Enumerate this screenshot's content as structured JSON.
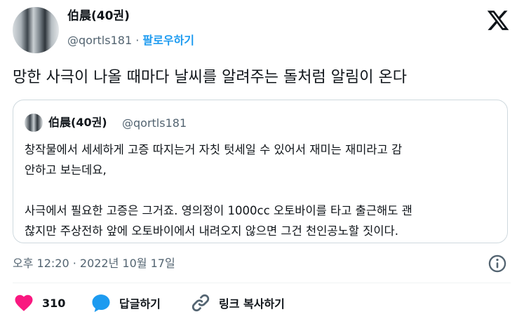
{
  "author": {
    "name": "伯晨(40권)",
    "handle": "@qortls181",
    "separator": "·",
    "follow_label": "팔로우하기"
  },
  "tweet": {
    "text": "망한 사극이 나올 때마다 날씨를 알려주는 돌처럼 알림이 온다"
  },
  "quoted_tweet": {
    "name": "伯晨(40권)",
    "handle": "@qortls181",
    "body": "창작물에서 세세하게 고증 따지는거 자칫 텃세일 수 있어서 재미는 재미라고 감\n안하고 보는데요,\n\n사극에서 필요한 고증은 그거죠. 영의정이 1000cc 오토바이를 타고 출근해도 괜\n찮지만 주상전하 앞에 오토바이에서 내려오지 않으면 그건 천인공노할 짓이다."
  },
  "meta": {
    "timestamp": "오후 12:20 · 2022년 10월 17일"
  },
  "actions": {
    "like_count": "310",
    "reply_label": "답글하기",
    "copy_link_label": "링크 복사하기"
  },
  "colors": {
    "accent": "#1d9bf0",
    "like": "#f91880",
    "secondary_text": "#536471"
  },
  "icons": {
    "logo": "x-logo-icon",
    "info": "info-icon",
    "like": "heart-icon",
    "reply": "speech-bubble-icon",
    "link": "link-icon"
  }
}
